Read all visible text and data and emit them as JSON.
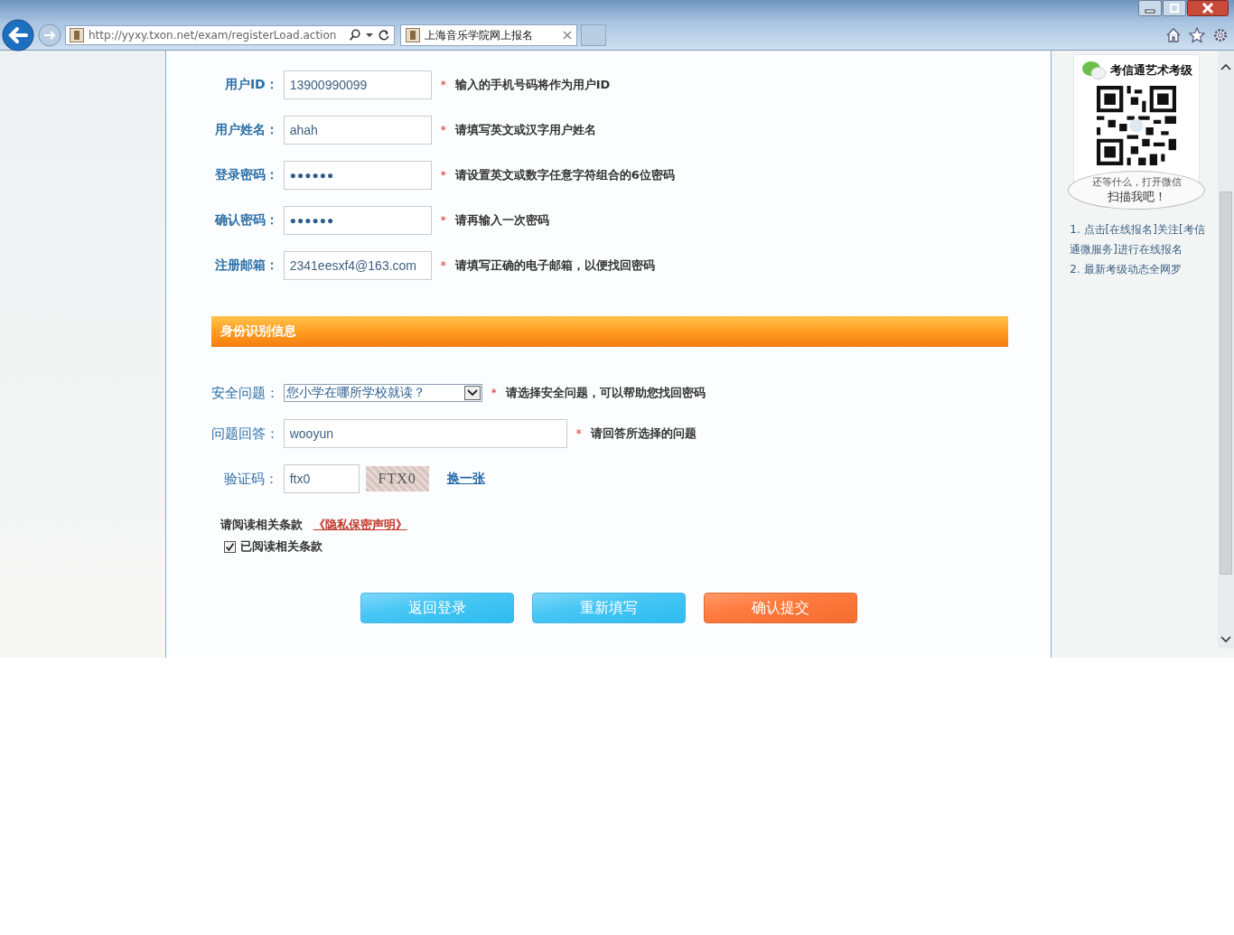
{
  "browser": {
    "url": "http://yyxy.txon.net/exam/registerLoad.action",
    "tab": {
      "title": "上海音乐学院网上报名",
      "selected": true
    }
  },
  "account_fields": [
    {
      "label": "用户ID：",
      "value": "13900990099",
      "kind": "text",
      "mark": "*",
      "hint": "输入的手机号码将作为用户ID"
    },
    {
      "label": "用户姓名：",
      "value": "ahah",
      "kind": "text",
      "mark": "*",
      "hint": "请填写英文或汉字用户姓名"
    },
    {
      "label": "登录密码：",
      "value": "●●●●●●",
      "kind": "password",
      "mark": "*",
      "hint": "请设置英文或数字任意字符组合的6位密码"
    },
    {
      "label": "确认密码：",
      "value": "●●●●●●",
      "kind": "password",
      "mark": "*",
      "hint": "请再输入一次密码"
    },
    {
      "label": "注册邮箱：",
      "value": "2341eesxf4@163.com",
      "kind": "text",
      "mark": "*",
      "hint": "请填写正确的电子邮箱，以便找回密码"
    }
  ],
  "section": {
    "title": "身份识别信息"
  },
  "security_question": {
    "label": "安全问题：",
    "value": "您小学在哪所学校就读？",
    "mark": "*",
    "hint": "请选择安全问题，可以帮助您找回密码"
  },
  "answer": {
    "label": "问题回答：",
    "value": "wooyun",
    "mark": "*",
    "hint": "请回答所选择的问题"
  },
  "captcha": {
    "label": "验证码：",
    "value": "ftx0",
    "image_text": "FTX0",
    "refresh": "换一张"
  },
  "terms": {
    "text": "请阅读相关条款",
    "link": "《隐私保密声明》",
    "checkbox": {
      "label": "已阅读相关条款",
      "checked": true
    }
  },
  "buttons": [
    {
      "label": "返回登录",
      "kind": "blue"
    },
    {
      "label": "重新填写",
      "kind": "blue"
    },
    {
      "label": "确认提交",
      "kind": "orange"
    }
  ],
  "sidebar": {
    "title": "考信通艺术考级",
    "bubble": [
      "还等什么，打开微信",
      "扫描我吧！"
    ],
    "notes": [
      "1. 点击[在线报名]关注[考信通微服务]进行在线报名",
      "2. 最新考级动态全网罗"
    ]
  }
}
